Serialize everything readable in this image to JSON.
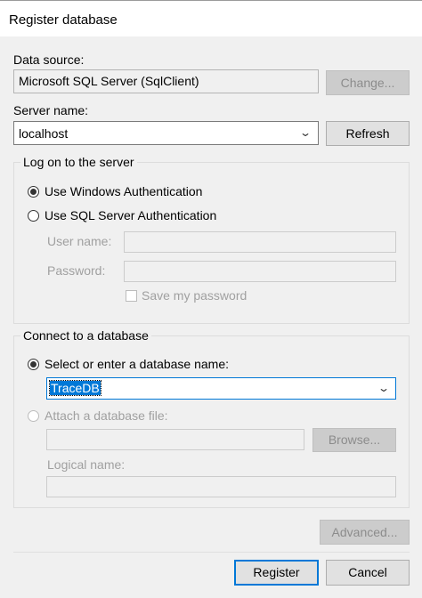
{
  "window": {
    "title": "Register database"
  },
  "data_source": {
    "label": "Data source:",
    "value": "Microsoft SQL Server (SqlClient)",
    "change_label": "Change..."
  },
  "server": {
    "label": "Server name:",
    "value": "localhost",
    "refresh_label": "Refresh"
  },
  "logon": {
    "legend": "Log on to the server",
    "windows_auth_label": "Use Windows Authentication",
    "sql_auth_label": "Use SQL Server Authentication",
    "username_label": "User name:",
    "password_label": "Password:",
    "save_password_label": "Save my password",
    "selected": "windows"
  },
  "database": {
    "legend": "Connect to a database",
    "select_label": "Select or enter a database name:",
    "db_name": "TraceDB",
    "attach_label": "Attach a database file:",
    "browse_label": "Browse...",
    "logical_name_label": "Logical name:"
  },
  "footer": {
    "advanced_label": "Advanced...",
    "register_label": "Register",
    "cancel_label": "Cancel"
  },
  "colors": {
    "accent": "#0078d7",
    "background": "#f0f0f0"
  },
  "icons": {
    "dropdown": "chevron-down-icon"
  }
}
